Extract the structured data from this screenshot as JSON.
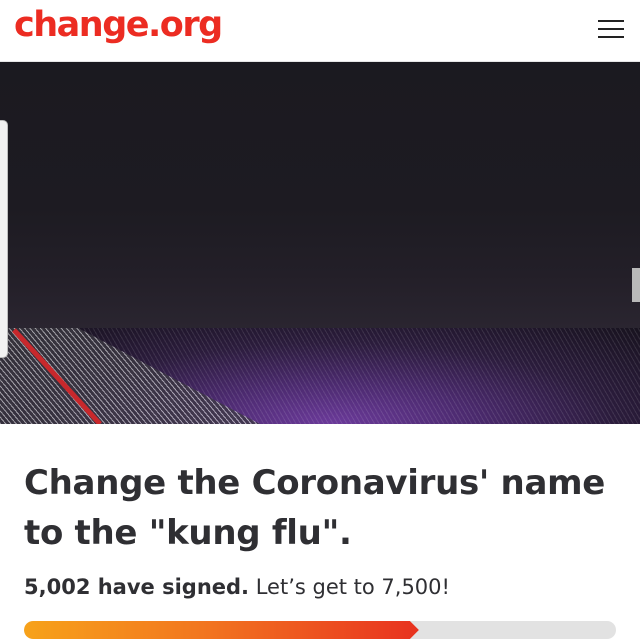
{
  "header": {
    "logo_text": "change.org",
    "menu_icon": "hamburger-menu-icon"
  },
  "colors": {
    "brand": "#ec2c22",
    "progress_start": "#f7a21a",
    "progress_end": "#e8321f",
    "track": "#e2e2e2",
    "text": "#2f2f33"
  },
  "petition": {
    "title": "Change the Coronavirus' name to the \"kung flu\".",
    "signed_count": "5,002 have signed.",
    "goal_text": " Let’s get to 7,500!",
    "progress_fraction": 0.667
  }
}
